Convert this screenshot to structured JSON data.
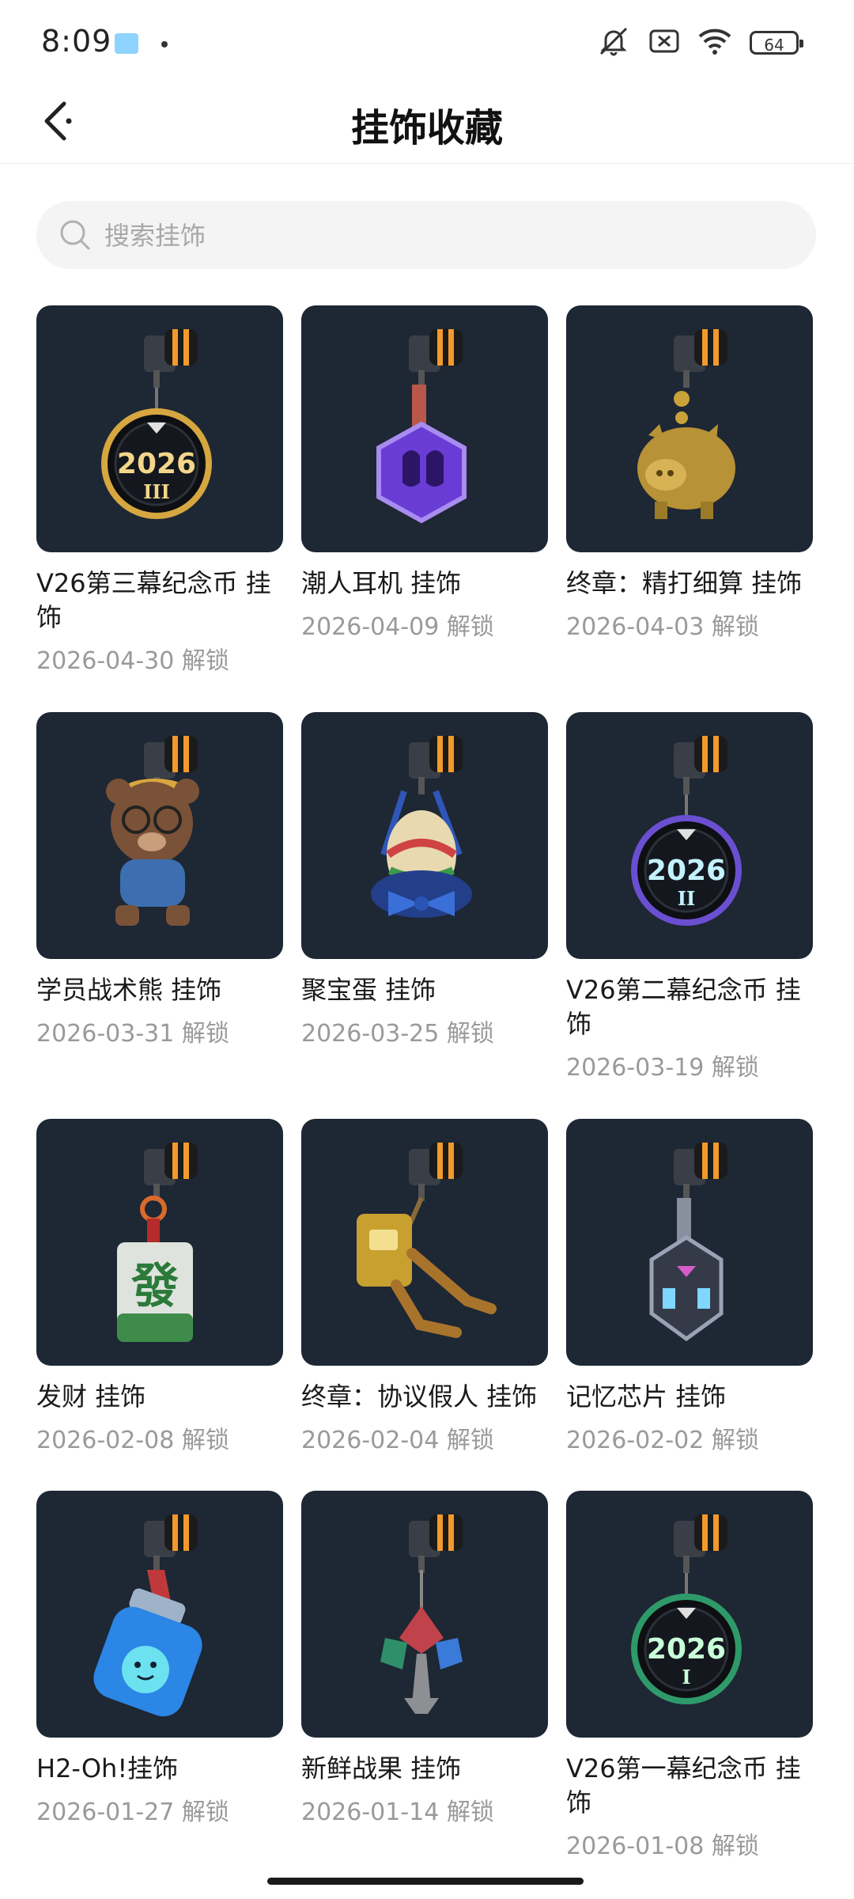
{
  "status_bar": {
    "time": "8:09",
    "battery": "64"
  },
  "header": {
    "title": "挂饰收藏"
  },
  "search": {
    "placeholder": "搜索挂饰"
  },
  "unlock_suffix": "解锁",
  "items": [
    {
      "name": "V26第三幕纪念币 挂饰",
      "date": "2026-04-30",
      "unlock": "解锁",
      "icon": "coin-charm-2026-iii",
      "art": "coin",
      "roman": "III",
      "ring": "#d6a640",
      "textColor": "#f3d68a"
    },
    {
      "name": "潮人耳机 挂饰",
      "date": "2026-04-09",
      "unlock": "解锁",
      "icon": "headphones-hex-charm",
      "art": "hex"
    },
    {
      "name": "终章：精打细算 挂饰",
      "date": "2026-04-03",
      "unlock": "解锁",
      "icon": "gold-piggy-bank-charm",
      "art": "pig"
    },
    {
      "name": "学员战术熊 挂饰",
      "date": "2026-03-31",
      "unlock": "解锁",
      "icon": "tactical-bear-charm",
      "art": "bear"
    },
    {
      "name": "聚宝蛋 挂饰",
      "date": "2026-03-25",
      "unlock": "解锁",
      "icon": "treasure-egg-charm",
      "art": "egg"
    },
    {
      "name": "V26第二幕纪念币 挂饰",
      "date": "2026-03-19",
      "unlock": "解锁",
      "icon": "coin-charm-2026-ii",
      "art": "coin",
      "roman": "II",
      "ring": "#6a4fd1",
      "textColor": "#c3f2ff"
    },
    {
      "name": "发财 挂饰",
      "date": "2026-02-08",
      "unlock": "解锁",
      "icon": "mahjong-fa-tile-charm",
      "art": "mahjong",
      "tile": "發"
    },
    {
      "name": "终章：协议假人 挂饰",
      "date": "2026-02-04",
      "unlock": "解锁",
      "icon": "protocol-dummy-charm",
      "art": "robot"
    },
    {
      "name": "记忆芯片 挂饰",
      "date": "2026-02-02",
      "unlock": "解锁",
      "icon": "memory-chip-charm",
      "art": "chip"
    },
    {
      "name": "H2-Oh!挂饰",
      "date": "2026-01-27",
      "unlock": "解锁",
      "icon": "water-bottle-charm",
      "art": "bottle"
    },
    {
      "name": "新鲜战果 挂饰",
      "date": "2026-01-14",
      "unlock": "解锁",
      "icon": "fresh-fruit-tree-charm",
      "art": "tree"
    },
    {
      "name": "V26第一幕纪念币 挂饰",
      "date": "2026-01-08",
      "unlock": "解锁",
      "icon": "coin-charm-2026-i",
      "art": "coin",
      "roman": "I",
      "ring": "#2e9a6a",
      "textColor": "#c9ffd9"
    }
  ],
  "colors": {
    "thumb_bg": "#1e2734",
    "clip_orange": "#f19a2b",
    "text_secondary": "#9a9a9a"
  }
}
